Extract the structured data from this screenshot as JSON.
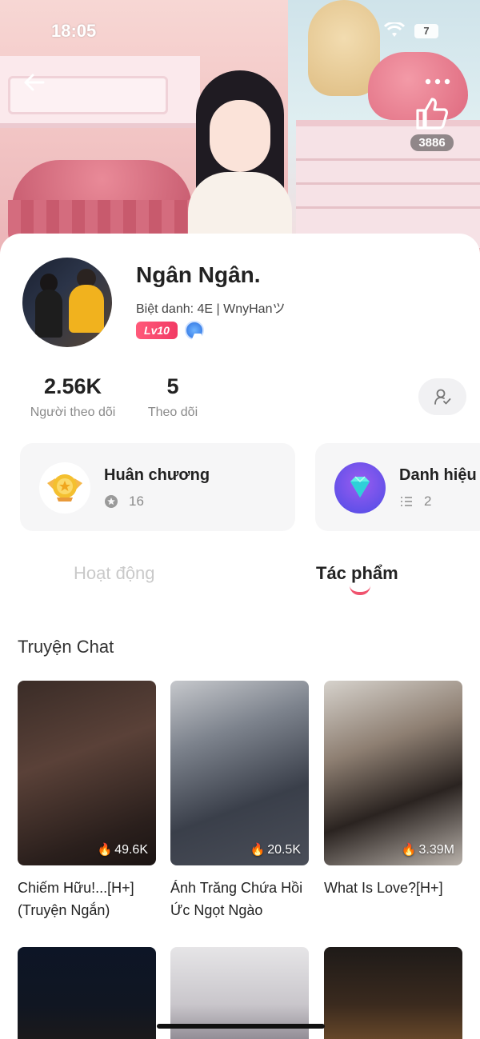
{
  "status_bar": {
    "time": "18:05",
    "battery": "7"
  },
  "header": {
    "like_count": "3886"
  },
  "profile": {
    "name": "Ngân Ngân.",
    "nickname": "Biệt danh: 4E | WnyHanツ",
    "level_badge": "Lv10"
  },
  "stats": {
    "followers_value": "2.56K",
    "followers_label": "Người theo dõi",
    "following_value": "5",
    "following_label": "Theo dõi"
  },
  "cards": {
    "medals": {
      "title": "Huân chương",
      "count": "16"
    },
    "titles": {
      "title": "Danh hiệu",
      "count": "2"
    }
  },
  "tabs": {
    "activity": "Hoạt động",
    "works": "Tác phẩm",
    "active": "works"
  },
  "section": {
    "title": "Truyện Chat"
  },
  "stories": [
    {
      "title": "Chiếm Hữu!...[H+] (Truyện Ngắn)",
      "views": "49.6K"
    },
    {
      "title": "Ánh Trăng Chứa Hồi Ức Ngọt Ngào",
      "views": "20.5K"
    },
    {
      "title": "What Is Love?[H+]",
      "views": "3.39M"
    }
  ],
  "colors": {
    "accent": "#f0536e",
    "level_badge": "#f23a64",
    "card_bg": "#f6f6f7"
  },
  "icons": [
    "back-arrow-icon",
    "more-icon",
    "thumbs-up-icon",
    "wifi-icon",
    "battery-icon",
    "follow-user-icon",
    "medal-icon",
    "diamond-icon",
    "star-icon",
    "list-icon",
    "fire-icon",
    "vip-badge-icon"
  ]
}
